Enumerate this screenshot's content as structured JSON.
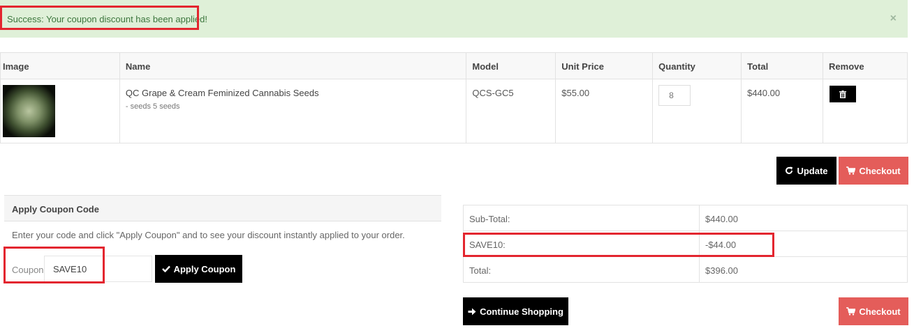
{
  "alert": {
    "message": "Success: Your coupon discount has been applied!",
    "close": "×",
    "color": "#dff0d8"
  },
  "cart": {
    "headers": [
      "Image",
      "Name",
      "Model",
      "Unit Price",
      "Quantity",
      "Total",
      "Remove"
    ],
    "rows": [
      {
        "name": "QC Grape & Cream Feminized Cannabis Seeds",
        "option": "- seeds 5 seeds",
        "model": "QCS-GC5",
        "unit_price": "$55.00",
        "quantity": "8",
        "total": "$440.00",
        "remove_icon": "trash-icon"
      }
    ]
  },
  "buttons": {
    "update": "Update",
    "checkout": "Checkout",
    "apply_coupon": "Apply Coupon",
    "continue_shopping": "Continue Shopping"
  },
  "coupon": {
    "title": "Apply Coupon Code",
    "description": "Enter your code and click \"Apply Coupon\" and to see your discount instantly applied to your order.",
    "label": "Coupon:",
    "value": "SAVE10"
  },
  "totals": [
    {
      "label": "Sub-Total:",
      "value": "$440.00"
    },
    {
      "label": "SAVE10:",
      "value": "-$44.00"
    },
    {
      "label": "Total:",
      "value": "$396.00"
    }
  ],
  "colors": {
    "success_text": "#3c763d",
    "checkout_red": "#e45d5a",
    "highlight_red": "#e3262f",
    "button_black": "#000000"
  }
}
